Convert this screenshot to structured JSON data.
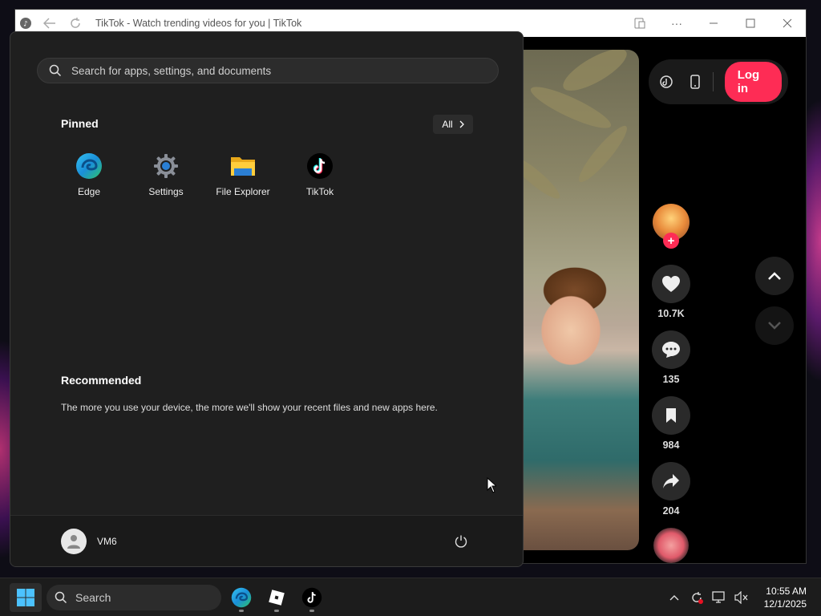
{
  "browser": {
    "title": "TikTok - Watch trending videos for you | TikTok"
  },
  "tiktok": {
    "login_label": "Log in",
    "likes": "10.7K",
    "comments": "135",
    "bookmarks": "984",
    "shares": "204",
    "accent_color": "#fe2c55"
  },
  "start_menu": {
    "search_placeholder": "Search for apps, settings, and documents",
    "pinned_title": "Pinned",
    "all_label": "All",
    "pinned_apps": [
      {
        "label": "Edge",
        "icon": "edge-icon"
      },
      {
        "label": "Settings",
        "icon": "settings-gear-icon"
      },
      {
        "label": "File Explorer",
        "icon": "folder-icon"
      },
      {
        "label": "TikTok",
        "icon": "tiktok-icon"
      }
    ],
    "recommended_title": "Recommended",
    "recommended_text": "The more you use your device, the more we'll show your recent files and new apps here.",
    "user_name": "VM6"
  },
  "taskbar": {
    "search_label": "Search",
    "time": "10:55 AM",
    "date": "12/1/2025"
  }
}
